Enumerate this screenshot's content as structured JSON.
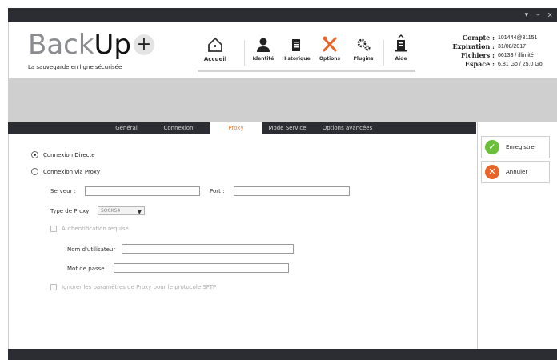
{
  "window": {
    "minimize_glyph": "–",
    "close_glyph": "x",
    "menu_glyph": "▾"
  },
  "brand": {
    "name_part1": "Back",
    "name_part2": "Up",
    "plus": "+",
    "tagline": "La sauvegarde en ligne sécurisée"
  },
  "nav": {
    "items": [
      {
        "label": "Accueil",
        "icon": "home-icon"
      },
      {
        "label": "Identité",
        "icon": "user-icon"
      },
      {
        "label": "Historique",
        "icon": "document-icon"
      },
      {
        "label": "Options",
        "icon": "tools-icon"
      },
      {
        "label": "Plugins",
        "icon": "gears-icon"
      },
      {
        "label": "Aide",
        "icon": "help-icon"
      }
    ]
  },
  "account": {
    "compte_label": "Compte :",
    "compte_value": "101444@31151",
    "expiration_label": "Expiration :",
    "expiration_value": "31/08/2017",
    "fichiers_label": "Fichiers :",
    "fichiers_value": "66133 / illimité",
    "espace_label": "Espace :",
    "espace_value": "6,81 Go / 25,0 Go"
  },
  "tabs": [
    {
      "label": "Général"
    },
    {
      "label": "Connexion"
    },
    {
      "label": "Proxy",
      "active": true
    },
    {
      "label": "Mode Service"
    },
    {
      "label": "Options avancées"
    }
  ],
  "proxy": {
    "direct_label": "Connexion Directe",
    "via_proxy_label": "Connexion via Proxy",
    "server_label": "Serveur :",
    "server_value": "",
    "port_label": "Port :",
    "port_value": "",
    "type_label": "Type de Proxy",
    "type_value": "SOCKS4",
    "auth_label": "Authentification requise",
    "username_label": "Nom d'utilisateur",
    "username_value": "",
    "password_label": "Mot de passe",
    "password_value": "",
    "ignore_sftp_label": "Ignorer les paramètres de Proxy pour le protocole SFTP"
  },
  "actions": {
    "save_label": "Enregistrer",
    "cancel_label": "Annuler"
  },
  "colors": {
    "dark_bar": "#2b2d33",
    "active_tab_text": "#e8803a",
    "save_green": "#6cbf3a",
    "cancel_orange": "#e8652a"
  }
}
